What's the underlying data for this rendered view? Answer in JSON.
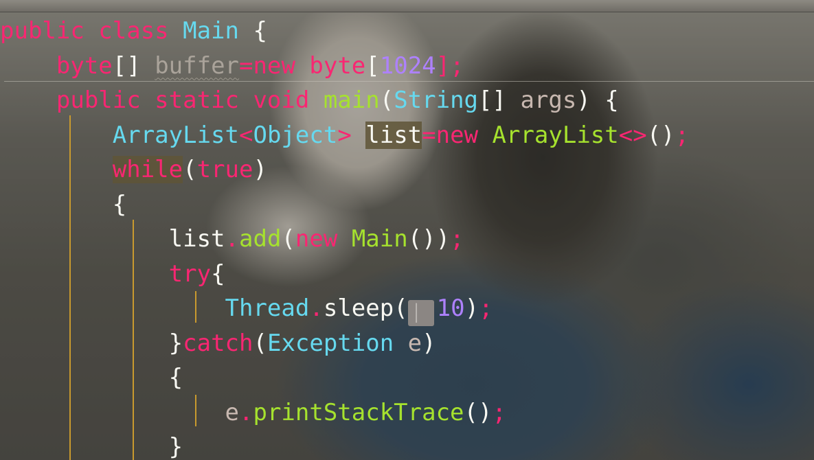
{
  "editor": {
    "code_lines": [
      [
        {
          "t": "public class ",
          "c": "kw"
        },
        {
          "t": "Main",
          "c": "cls"
        },
        {
          "t": " {",
          "c": "plain"
        }
      ],
      [
        {
          "t": "    ",
          "c": "plain"
        },
        {
          "t": "byte",
          "c": "kw"
        },
        {
          "t": "[] ",
          "c": "plain"
        },
        {
          "t": "buffer",
          "c": "dim warn"
        },
        {
          "t": "=new ",
          "c": "kw"
        },
        {
          "t": "byte",
          "c": "kw"
        },
        {
          "t": "[",
          "c": "plain"
        },
        {
          "t": "1024",
          "c": "num"
        },
        {
          "t": "];",
          "c": "kw"
        }
      ],
      [
        {
          "t": "    ",
          "c": "plain"
        },
        {
          "t": "public static void ",
          "c": "kw"
        },
        {
          "t": "main",
          "c": "fn"
        },
        {
          "t": "(",
          "c": "plain"
        },
        {
          "t": "String",
          "c": "cls"
        },
        {
          "t": "[] ",
          "c": "plain"
        },
        {
          "t": "args",
          "c": "param"
        },
        {
          "t": ") {",
          "c": "plain"
        }
      ],
      [
        {
          "t": "        ",
          "c": "plain"
        },
        {
          "t": "ArrayList",
          "c": "cls"
        },
        {
          "t": "<",
          "c": "kw"
        },
        {
          "t": "Object",
          "c": "cls"
        },
        {
          "t": "> ",
          "c": "kw"
        },
        {
          "t": "list",
          "c": "plain hl"
        },
        {
          "t": "=new ",
          "c": "kw"
        },
        {
          "t": "ArrayList",
          "c": "fn"
        },
        {
          "t": "<>",
          "c": "kw"
        },
        {
          "t": "()",
          "c": "plain"
        },
        {
          "t": ";",
          "c": "kw"
        }
      ],
      [
        {
          "t": "        ",
          "c": "plain"
        },
        {
          "t": "while",
          "c": "kw hl"
        },
        {
          "t": "(",
          "c": "plain"
        },
        {
          "t": "true",
          "c": "kw"
        },
        {
          "t": ")",
          "c": "plain"
        }
      ],
      [
        {
          "t": "        ",
          "c": "plain"
        },
        {
          "t": "{",
          "c": "plain"
        }
      ],
      [
        {
          "t": "            ",
          "c": "plain"
        },
        {
          "t": "list",
          "c": "plain"
        },
        {
          "t": ".",
          "c": "kw"
        },
        {
          "t": "add",
          "c": "fn"
        },
        {
          "t": "(",
          "c": "plain"
        },
        {
          "t": "new ",
          "c": "kw"
        },
        {
          "t": "Main",
          "c": "fn"
        },
        {
          "t": "())",
          "c": "plain"
        },
        {
          "t": ";",
          "c": "kw"
        }
      ],
      [
        {
          "t": "            ",
          "c": "plain"
        },
        {
          "t": "try",
          "c": "kw"
        },
        {
          "t": "{",
          "c": "plain"
        }
      ],
      [
        {
          "t": "                ",
          "c": "plain"
        },
        {
          "t": "Thread",
          "c": "cls"
        },
        {
          "t": ".",
          "c": "kw"
        },
        {
          "t": "sleep",
          "c": "plain"
        },
        {
          "t": "(",
          "c": "plain"
        },
        {
          "t": "▏",
          "c": "hint"
        },
        {
          "t": "10",
          "c": "num"
        },
        {
          "t": ")",
          "c": "plain"
        },
        {
          "t": ";",
          "c": "kw"
        }
      ],
      [
        {
          "t": "            ",
          "c": "plain"
        },
        {
          "t": "}",
          "c": "plain"
        },
        {
          "t": "catch",
          "c": "kw"
        },
        {
          "t": "(",
          "c": "plain"
        },
        {
          "t": "Exception",
          "c": "cls"
        },
        {
          "t": " e",
          "c": "param"
        },
        {
          "t": ")",
          "c": "plain"
        }
      ],
      [
        {
          "t": "            ",
          "c": "plain"
        },
        {
          "t": "{",
          "c": "plain"
        }
      ],
      [
        {
          "t": "                ",
          "c": "plain"
        },
        {
          "t": "e",
          "c": "param"
        },
        {
          "t": ".",
          "c": "kw"
        },
        {
          "t": "printStackTrace",
          "c": "fn"
        },
        {
          "t": "()",
          "c": "plain"
        },
        {
          "t": ";",
          "c": "kw"
        }
      ],
      [
        {
          "t": "            ",
          "c": "plain"
        },
        {
          "t": "}",
          "c": "plain"
        }
      ]
    ]
  }
}
